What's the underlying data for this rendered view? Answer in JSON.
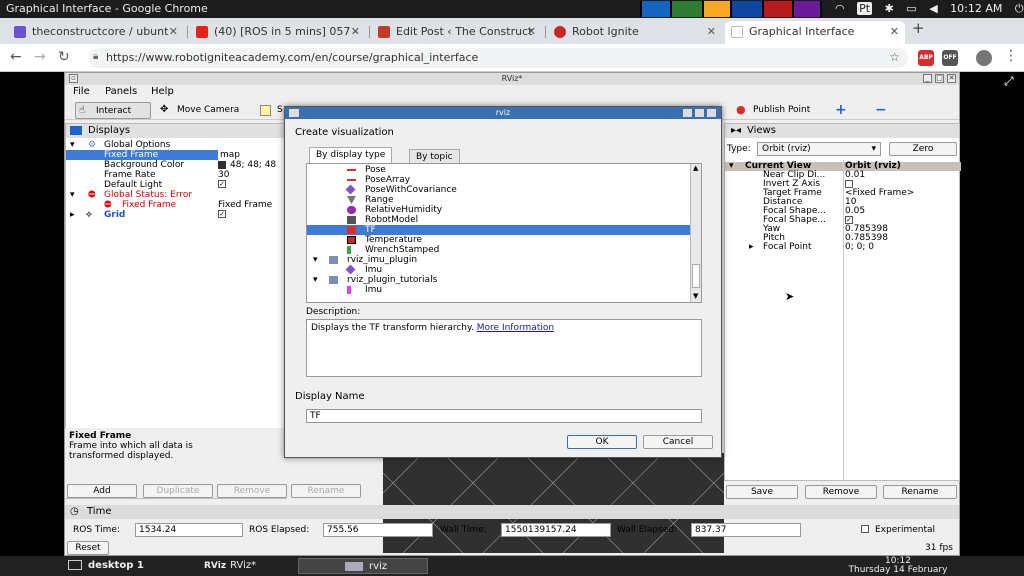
{
  "os": {
    "window_title": "Graphical Interface - Google Chrome",
    "time": "10:12 AM",
    "pt_badge": "Pt"
  },
  "chrome": {
    "tabs": [
      {
        "label": "theconstructcore / ubunt",
        "favicon_color": "#6d4ed0"
      },
      {
        "label": "(40) [ROS in 5 mins] 057 -",
        "favicon_color": "#e62117"
      },
      {
        "label": "Edit Post ‹ The Construct",
        "favicon_color": "#c0392b"
      },
      {
        "label": "Robot Ignite",
        "favicon_color": "#c62828"
      },
      {
        "label": "Graphical Interface",
        "favicon_color": "#ffffff"
      }
    ],
    "url": "https://www.robotigniteacademy.com/en/course/graphical_interface",
    "ext_abp": "ABP",
    "ext_off": "OFF"
  },
  "rviz": {
    "title": "RViz*",
    "menus": [
      "File",
      "Panels",
      "Help"
    ],
    "tools": {
      "interact": "Interact",
      "move_camera": "Move Camera",
      "select": "S",
      "publish_point": "Publish Point"
    },
    "displays": {
      "title": "Displays",
      "rows": [
        {
          "label": "Global Options",
          "value": ""
        },
        {
          "label": "Fixed Frame",
          "value": "map"
        },
        {
          "label": "Background Color",
          "value": "48; 48; 48"
        },
        {
          "label": "Frame Rate",
          "value": "30"
        },
        {
          "label": "Default Light",
          "value": "✓"
        },
        {
          "label": "Global Status: Error",
          "value": ""
        },
        {
          "label": "Fixed Frame",
          "value": "Fixed Frame"
        },
        {
          "label": "Grid",
          "value": "✓"
        }
      ],
      "desc_title": "Fixed Frame",
      "desc_text": "Frame into which all data is transformed displayed.",
      "buttons": {
        "add": "Add",
        "duplicate": "Duplicate",
        "remove": "Remove",
        "rename": "Rename"
      }
    },
    "views": {
      "title": "Views",
      "type_label": "Type:",
      "type_value": "Orbit (rviz)",
      "zero": "Zero",
      "rows": [
        {
          "label": "Current View",
          "value": "Orbit (rviz)"
        },
        {
          "label": "Near Clip Di...",
          "value": "0.01"
        },
        {
          "label": "Invert Z Axis",
          "value": ""
        },
        {
          "label": "Target Frame",
          "value": "<Fixed Frame>"
        },
        {
          "label": "Distance",
          "value": "10"
        },
        {
          "label": "Focal Shape...",
          "value": "0.05"
        },
        {
          "label": "Focal Shape...",
          "value": "✓"
        },
        {
          "label": "Yaw",
          "value": "0.785398"
        },
        {
          "label": "Pitch",
          "value": "0.785398"
        },
        {
          "label": "Focal Point",
          "value": "0; 0; 0"
        }
      ],
      "buttons": {
        "save": "Save",
        "remove": "Remove",
        "rename": "Rename"
      }
    },
    "time": {
      "title": "Time",
      "ros_time_label": "ROS Time:",
      "ros_time": "1534.24",
      "ros_elapsed_label": "ROS Elapsed:",
      "ros_elapsed": "755.56",
      "wall_time_label": "Wall Time:",
      "wall_time": "1550139157.24",
      "wall_elapsed_label": "Wall Elapsed:",
      "wall_elapsed": "837.37",
      "experimental": "Experimental",
      "reset": "Reset",
      "fps": "31 fps"
    }
  },
  "dialog": {
    "title": "rviz",
    "heading": "Create visualization",
    "tabs": [
      "By display type",
      "By topic"
    ],
    "items": [
      {
        "label": "Pose",
        "icon_color": "#d32f2f",
        "indent": 1
      },
      {
        "label": "PoseArray",
        "icon_color": "#d32f2f",
        "indent": 1
      },
      {
        "label": "PoseWithCovariance",
        "icon_color": "#7e57c2",
        "indent": 1
      },
      {
        "label": "Range",
        "icon_color": "#777777",
        "indent": 1
      },
      {
        "label": "RelativeHumidity",
        "icon_color": "#9c27b0",
        "indent": 1
      },
      {
        "label": "RobotModel",
        "icon_color": "#555555",
        "indent": 1
      },
      {
        "label": "TF",
        "icon_color": "#d32f2f",
        "indent": 1
      },
      {
        "label": "Temperature",
        "icon_color": "#c62828",
        "indent": 1
      },
      {
        "label": "WrenchStamped",
        "icon_color": "#43a047",
        "indent": 1
      },
      {
        "label": "rviz_imu_plugin",
        "icon_color": "#7a8fb3",
        "indent": 0
      },
      {
        "label": "Imu",
        "icon_color": "#7e57c2",
        "indent": 1
      },
      {
        "label": "rviz_plugin_tutorials",
        "icon_color": "#7a8fb3",
        "indent": 0
      },
      {
        "label": "Imu",
        "icon_color": "#e040fb",
        "indent": 1
      }
    ],
    "description_label": "Description:",
    "description_text": "Displays the TF transform hierarchy.",
    "more_info": "More Information",
    "display_name_label": "Display Name",
    "display_name": "TF",
    "ok": "OK",
    "cancel": "Cancel"
  },
  "taskbar": {
    "desktop": "desktop 1",
    "rviz_app": "RViz*",
    "rviz_badge": "RViz",
    "rviz_dialog": "rviz",
    "clock_time": "10:12",
    "clock_date": "Thursday 14 February"
  }
}
